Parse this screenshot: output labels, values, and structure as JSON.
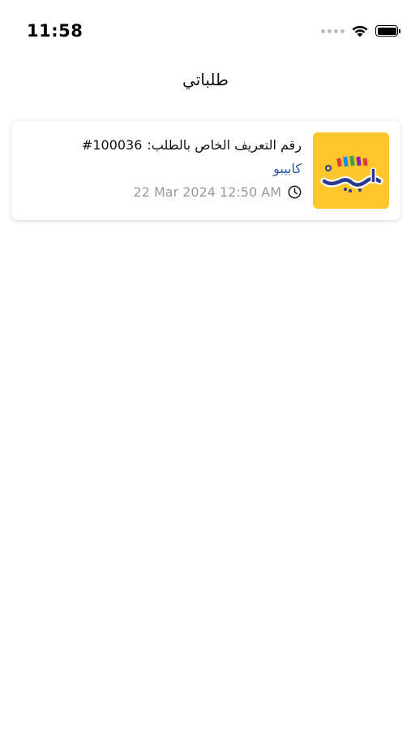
{
  "status_bar": {
    "time": "11:58",
    "icons": [
      "signal-dots-icon",
      "wifi-icon",
      "battery-icon"
    ]
  },
  "header": {
    "title": "طلباتي"
  },
  "orders": [
    {
      "id_label": "رقم التعريف الخاص بالطلب:",
      "id_value": "#100036",
      "store_name": "كابيبو",
      "date": "22 Mar 2024  12:50 AM",
      "logo_text": "كابيبو",
      "logo_bg": "#FFC72C"
    }
  ],
  "colors": {
    "store_link": "#2e5aa8",
    "muted_text": "#9a9a9a",
    "logo_background": "#FFC72C"
  }
}
